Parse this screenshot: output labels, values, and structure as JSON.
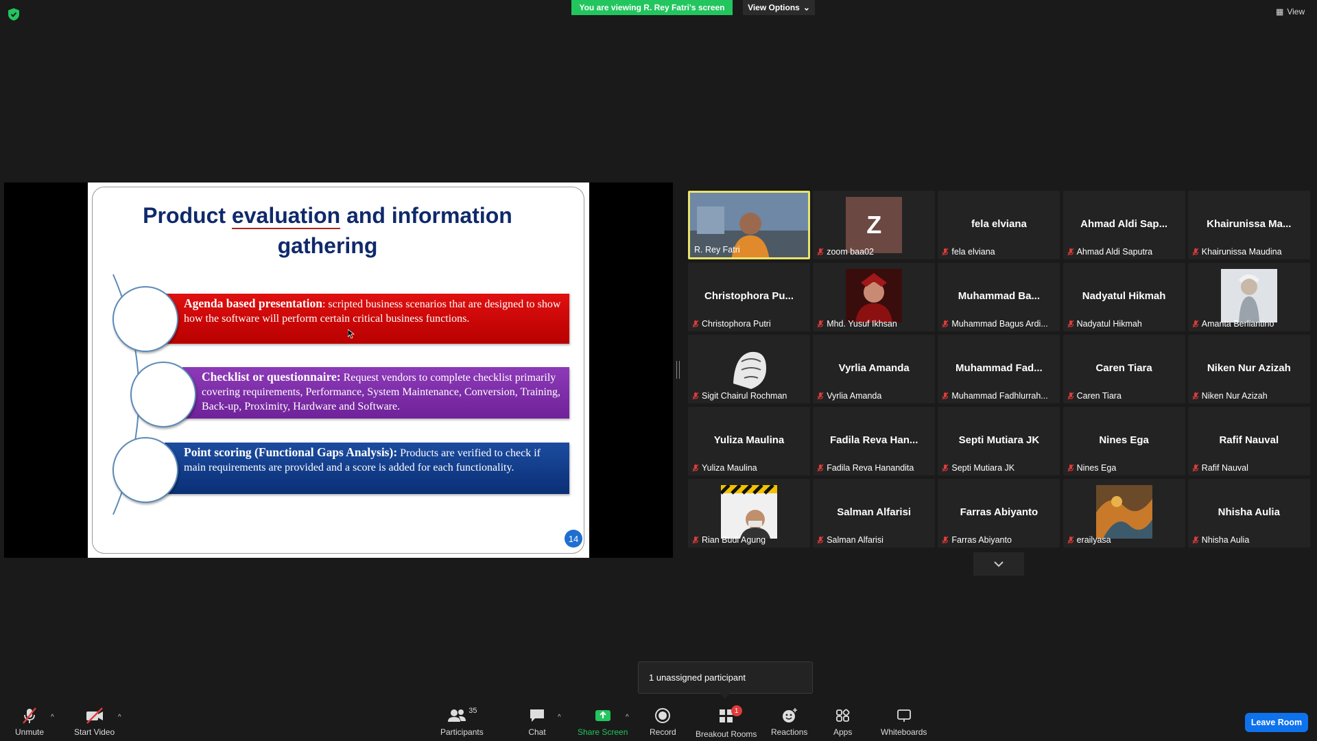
{
  "banner": {
    "text": "You are viewing R. Rey Fatri's screen",
    "view_options": "View Options"
  },
  "view_button": "View",
  "slide": {
    "title_part1": "Product ",
    "title_underlined": "evaluation",
    "title_part2": " and information",
    "title_line2": "gathering",
    "items": [
      {
        "bold": "Agenda based presentation",
        "text": ": scripted business scenarios that are designed to show how the software will perform certain critical business functions."
      },
      {
        "bold": "Checklist or questionnaire:",
        "text": " Request vendors to complete checklist primarily covering requirements, Performance, System Maintenance, Conversion, Training, Back-up, Proximity, Hardware and Software."
      },
      {
        "bold": "Point scoring (Functional Gaps Analysis):",
        "text": " Products are verified to check if main requirements are provided and a score is added for each functionality."
      }
    ],
    "page_number": "14"
  },
  "participants": [
    {
      "big": "",
      "name": "R. Rey Fatri",
      "type": "video"
    },
    {
      "big": "Z",
      "name": "zoom baa02",
      "type": "avatar-z"
    },
    {
      "big": "fela elviana",
      "name": "fela elviana",
      "type": "text"
    },
    {
      "big": "Ahmad  Aldi  Sap...",
      "name": "Ahmad Aldi Saputra",
      "type": "text"
    },
    {
      "big": "Khairunissa  Ma...",
      "name": "Khairunissa Maudina",
      "type": "text"
    },
    {
      "big": "Christophora  Pu...",
      "name": "Christophora Putri",
      "type": "text"
    },
    {
      "big": "",
      "name": "Mhd. Yusuf Ikhsan",
      "type": "pic-red"
    },
    {
      "big": "Muhammad  Ba...",
      "name": "Muhammad Bagus Ardi...",
      "type": "text"
    },
    {
      "big": "Nadyatul Hikmah",
      "name": "Nadyatul Hikmah",
      "type": "text"
    },
    {
      "big": "",
      "name": "Amanta Berliantino",
      "type": "pic-white"
    },
    {
      "big": "",
      "name": "Sigit Chairul Rochman",
      "type": "pic-sketch"
    },
    {
      "big": "Vyrlia Amanda",
      "name": "Vyrlia Amanda",
      "type": "text"
    },
    {
      "big": "Muhammad  Fad...",
      "name": "Muhammad Fadhlurrah...",
      "type": "text"
    },
    {
      "big": "Caren Tiara",
      "name": "Caren Tiara",
      "type": "text"
    },
    {
      "big": "Niken Nur Azizah",
      "name": "Niken Nur Azizah",
      "type": "text"
    },
    {
      "big": "Yuliza Maulina",
      "name": "Yuliza Maulina",
      "type": "text"
    },
    {
      "big": "Fadila Reva Han...",
      "name": "Fadila Reva Hanandita",
      "type": "text"
    },
    {
      "big": "Septi Mutiara JK",
      "name": "Septi Mutiara JK",
      "type": "text"
    },
    {
      "big": "Nines Ega",
      "name": "Nines Ega",
      "type": "text"
    },
    {
      "big": "Rafif Nauval",
      "name": "Rafif Nauval",
      "type": "text"
    },
    {
      "big": "",
      "name": "Rian Budi Agung",
      "type": "pic-construction"
    },
    {
      "big": "Salman Alfarisi",
      "name": "Salman Alfarisi",
      "type": "text"
    },
    {
      "big": "Farras Abiyanto",
      "name": "Farras Abiyanto",
      "type": "text"
    },
    {
      "big": "",
      "name": "erailyasa",
      "type": "pic-art"
    },
    {
      "big": "Nhisha Aulia",
      "name": "Nhisha Aulia",
      "type": "text"
    }
  ],
  "tooltip": "1 unassigned participant",
  "toolbar": {
    "unmute": "Unmute",
    "start_video": "Start Video",
    "participants": "Participants",
    "participants_count": "35",
    "chat": "Chat",
    "share_screen": "Share Screen",
    "record": "Record",
    "breakout_rooms": "Breakout Rooms",
    "breakout_badge": "1",
    "reactions": "Reactions",
    "apps": "Apps",
    "whiteboards": "Whiteboards",
    "leave": "Leave Room"
  },
  "colors": {
    "share_green": "#22c55e",
    "leave_blue": "#0e72ed",
    "mute_red": "#e03b3b",
    "active_speaker": "#e9e36a"
  }
}
